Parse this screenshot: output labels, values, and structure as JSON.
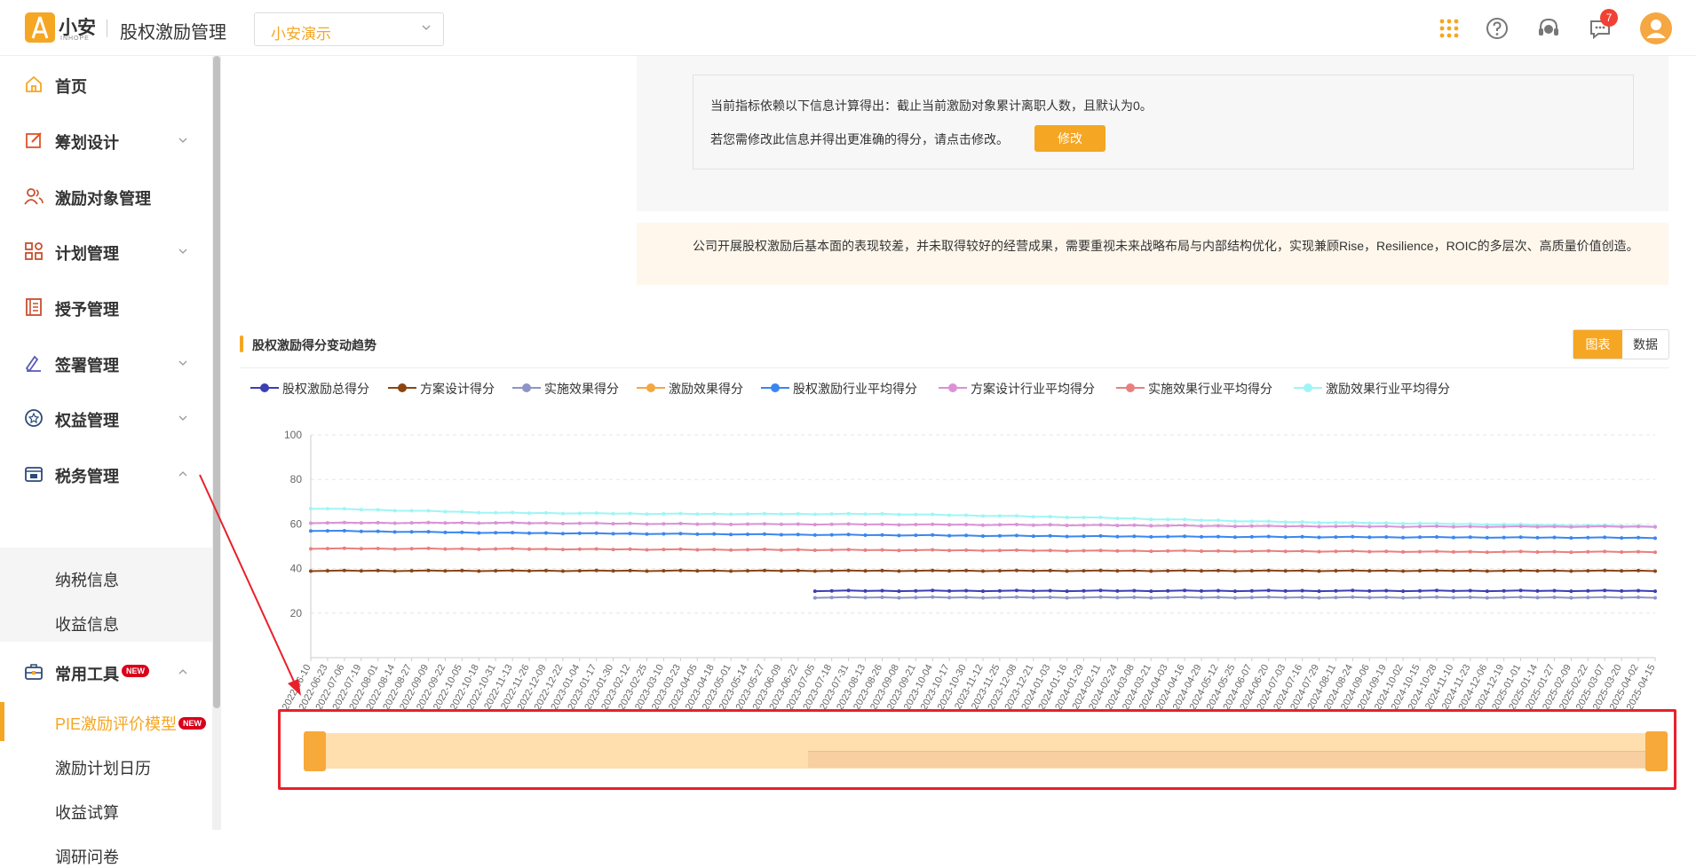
{
  "header": {
    "logo_text": "小安",
    "logo_sub": "INHOPE",
    "app_title": "股权激励管理",
    "company_value": "小安演示",
    "notification_count": "7"
  },
  "sidebar": {
    "items": [
      {
        "label": "首页",
        "icon": "home-icon"
      },
      {
        "label": "筹划设计",
        "icon": "edit-icon"
      },
      {
        "label": "激励对象管理",
        "icon": "users-icon"
      },
      {
        "label": "计划管理",
        "icon": "grid-icon"
      },
      {
        "label": "授予管理",
        "icon": "book-icon"
      },
      {
        "label": "签署管理",
        "icon": "sign-icon"
      },
      {
        "label": "权益管理",
        "icon": "badge-icon"
      },
      {
        "label": "税务管理",
        "icon": "tax-icon"
      }
    ],
    "tax_sub": [
      "纳税信息",
      "收益信息"
    ],
    "tools_label": "常用工具",
    "new_badge": "NEW",
    "tools_sub": [
      "PIE激励评价模型",
      "激励计划日历",
      "收益试算",
      "调研问卷"
    ]
  },
  "info": {
    "line1": "当前指标依赖以下信息计算得出：截止当前激励对象累计离职人数，且默认为0。",
    "line2": "若您需修改此信息并得出更准确的得分，请点击修改。",
    "modify_label": "修改"
  },
  "conclusion": "公司开展股权激励后基本面的表现较差，并未取得较好的经营成果，需要重视未来战略布局与内部结构优化，实现兼顾Rise，Resilience，ROIC的多层次、高质量价值创造。",
  "section": {
    "title": "股权激励得分变动趋势",
    "tab_chart": "图表",
    "tab_data": "数据"
  },
  "chart_data": {
    "type": "line",
    "ylim": [
      0,
      100
    ],
    "y_ticks": [
      20,
      40,
      60,
      80,
      100
    ],
    "x": [
      "2022-06-10",
      "2022-06-23",
      "2022-07-06",
      "2022-07-19",
      "2022-08-01",
      "2022-08-14",
      "2022-08-27",
      "2022-09-09",
      "2022-09-22",
      "2022-10-05",
      "2022-10-18",
      "2022-10-31",
      "2022-11-13",
      "2022-11-26",
      "2022-12-09",
      "2022-12-22",
      "2023-01-04",
      "2023-01-17",
      "2023-01-30",
      "2023-02-12",
      "2023-02-25",
      "2023-03-10",
      "2023-03-23",
      "2023-04-05",
      "2023-04-18",
      "2023-05-01",
      "2023-05-14",
      "2023-05-27",
      "2023-06-09",
      "2023-06-22",
      "2023-07-05",
      "2023-07-18",
      "2023-07-31",
      "2023-08-13",
      "2023-08-26",
      "2023-09-08",
      "2023-09-21",
      "2023-10-04",
      "2023-10-17",
      "2023-10-30",
      "2023-11-12",
      "2023-11-25",
      "2023-12-08",
      "2023-12-21",
      "2024-01-03",
      "2024-01-16",
      "2024-01-29",
      "2024-02-11",
      "2024-02-24",
      "2024-03-08",
      "2024-03-21",
      "2024-04-03",
      "2024-04-16",
      "2024-04-29",
      "2024-05-12",
      "2024-05-25",
      "2024-06-07",
      "2024-06-20",
      "2024-07-03",
      "2024-07-16",
      "2024-07-29",
      "2024-08-11",
      "2024-08-24",
      "2024-09-06",
      "2024-09-19",
      "2024-10-02",
      "2024-10-15",
      "2024-10-28",
      "2024-11-10",
      "2024-11-23",
      "2024-12-06",
      "2024-12-19",
      "2025-01-01",
      "2025-01-14",
      "2025-01-27",
      "2025-02-09",
      "2025-02-22",
      "2025-03-07",
      "2025-03-20",
      "2025-04-02",
      "2025-04-15"
    ],
    "series": [
      {
        "name": "股权激励总得分",
        "color": "#3c3eb5",
        "start_index": 30,
        "values": [
          30,
          30
        ]
      },
      {
        "name": "方案设计得分",
        "color": "#8b4513",
        "start_index": 0,
        "values": [
          39,
          39
        ]
      },
      {
        "name": "实施效果得分",
        "color": "#8e94c6",
        "start_index": 30,
        "values": [
          27,
          27
        ]
      },
      {
        "name": "激励效果得分",
        "color": "#f5a742",
        "start_index": 0,
        "values": []
      },
      {
        "name": "股权激励行业平均得分",
        "color": "#3a86f0",
        "start_index": 0,
        "values": [
          57,
          56,
          55.5,
          55,
          54.5,
          54.2,
          54,
          53.8
        ]
      },
      {
        "name": "方案设计行业平均得分",
        "color": "#d992d6",
        "start_index": 0,
        "values": [
          60.5,
          60.5,
          60,
          59.8,
          59.5,
          59,
          58.8,
          58.8
        ]
      },
      {
        "name": "实施效果行业平均得分",
        "color": "#e88080",
        "start_index": 0,
        "values": [
          49,
          48.8,
          48.5,
          48.3,
          48,
          47.8,
          47.5,
          47.5
        ]
      },
      {
        "name": "激励效果行业平均得分",
        "color": "#9ff5f5",
        "start_index": 0,
        "values": [
          67,
          65,
          64.5,
          64.5,
          63,
          61,
          60,
          59
        ]
      }
    ]
  }
}
